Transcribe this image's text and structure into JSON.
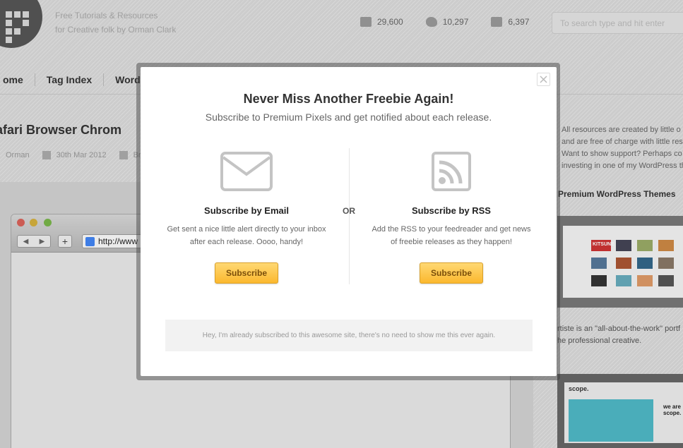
{
  "site": {
    "tagline_line1": "Free Tutorials & Resources",
    "tagline_line2": "for Creative folk by Orman Clark",
    "stats": {
      "rss": "29,600",
      "twitter": "10,297",
      "facebook": "6,397"
    },
    "search_placeholder": "To search type and hit enter"
  },
  "nav": {
    "items": [
      "ome",
      "Tag Index",
      "WordPr"
    ]
  },
  "post": {
    "title": "afari Browser Chrom",
    "author": "Orman",
    "date": "30th Mar 2012",
    "tag": "Br"
  },
  "browser_mock": {
    "url": "http://www"
  },
  "sidebar": {
    "lines": [
      "All resources are created by little o",
      "and are free of charge with little rest",
      "Want to show support? Perhaps co",
      "investing in one of my WordPress th"
    ],
    "heading": "Premium WordPress Themes",
    "thumb1_label": "KITSUNE",
    "desc_lines": [
      "rtiste is an \"all-about-the-work\" portf",
      "he professional creative."
    ],
    "thumb2_label": "scope.",
    "thumb2_tagline": "we are scope."
  },
  "modal": {
    "title": "Never Miss Another Freebie Again!",
    "subtitle": "Subscribe to Premium Pixels and get notified about each release.",
    "or_label": "OR",
    "email": {
      "heading": "Subscribe by Email",
      "desc_line1": "Get sent a nice little alert directly to your inbox",
      "desc_line2": "after each release. Oooo, handy!",
      "button": "Subscribe"
    },
    "rss": {
      "heading": "Subscribe by RSS",
      "desc_line1": "Add the RSS to your feedreader and get news",
      "desc_line2": "of freebie releases as they happen!",
      "button": "Subscribe"
    },
    "dismiss_text": "Hey, I'm already subscribed to this awesome site, there's no need to show me this ever again."
  },
  "colors": {
    "button_top": "#ffd873",
    "button_bottom": "#fbb82e",
    "icon_gray": "#c4c4c4"
  }
}
